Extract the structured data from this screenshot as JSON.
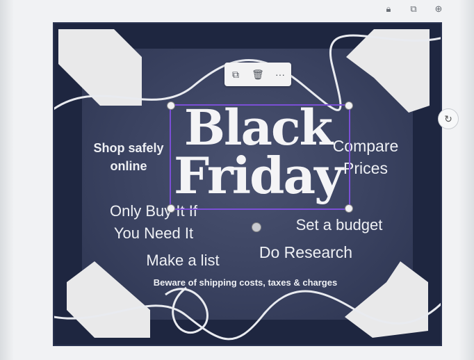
{
  "toolbar": {
    "icons": [
      "copy-icon",
      "delete-icon",
      "more-icon"
    ],
    "more_label": "···"
  },
  "topbar": {
    "icons": [
      "lock-icon",
      "duplicate-icon",
      "add-page-icon"
    ]
  },
  "canvas": {
    "headline_line1": "Black",
    "headline_line2": "Friday",
    "tip_shop_safely": "Shop safely\nonline",
    "tip_compare": "Compare\nPrices",
    "tip_only_buy": "Only Buy It If\nYou Need It",
    "tip_budget": "Set a budget",
    "tip_research": "Do Research",
    "tip_list": "Make a list",
    "tip_beware": "Beware of shipping costs, taxes & charges"
  },
  "colors": {
    "board": "#1e2640",
    "selection": "#7b4fd6",
    "text": "#eef0f4"
  }
}
